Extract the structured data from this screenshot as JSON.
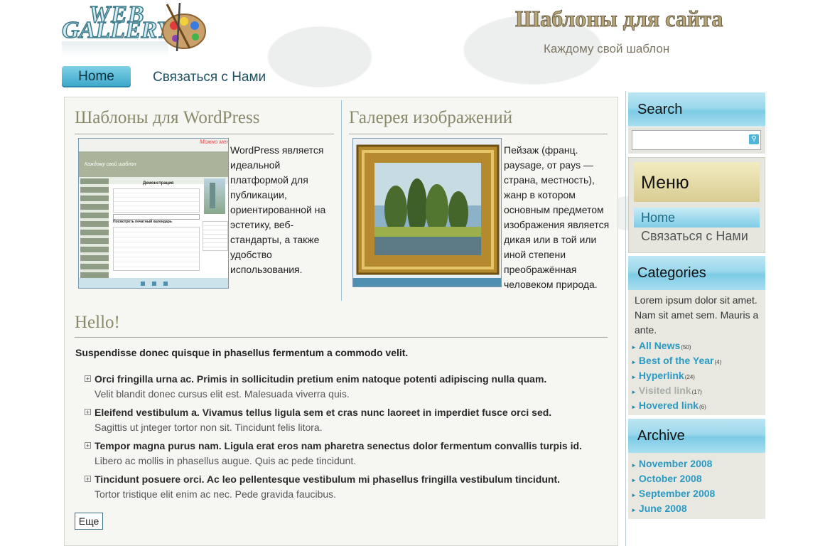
{
  "header": {
    "logo_word1": "WEB",
    "logo_word2": "GALLERY",
    "site_title": "Шаблоны для сайта",
    "slogan": "Каждому свой шаблон"
  },
  "topnav": {
    "home": "Home",
    "contact": "Связаться с Нами"
  },
  "wordpress": {
    "title": "Шаблоны для WordPress",
    "text": "WordPress является идеальной платформой для публикации, ориентированной на эстетику, веб-стандарты, а также удобство использования."
  },
  "gallery": {
    "title": "Галерея изображений",
    "text": "Пейзаж  (франц. paysage, от pays — страна, местность), жанр  в котором основным предметом изображения является дикая или в той или иной степени преображённая человеком природа."
  },
  "hello": {
    "title": "Hello!",
    "intro": "Suspendisse donec quisque in phasellus fermentum a commodo velit.",
    "items": [
      {
        "head": "Orci fringilla urna ac. Primis in sollicitudin pretium enim natoque potenti adipiscing nulla quam.",
        "sub": "Velit blandit donec cursus elit est. Malesuada viverra quis."
      },
      {
        "head": "Eleifend vestibulum a. Vivamus tellus ligula sem et cras nunc laoreet in imperdiet fusce orci sed.",
        "sub": "Sagittis ut jnteger tortor non sit. Tincidunt felis litora."
      },
      {
        "head": "Tempor magna purus nam. Ligula erat eros nam pharetra senectus dolor fermentum convallis turpis id.",
        "sub": "Libero ac mollis in phasellus augue. Quis ac pede tincidunt."
      },
      {
        "head": "Tincidunt posuere orci. Ac leo pellentesque vestibulum mi phasellus fringilla vestibulum tincidunt.",
        "sub": "Tortor tristique elit enim ac nec. Pede gravida faucibus."
      }
    ],
    "more": "Еще"
  },
  "sidebar": {
    "search_title": "Search",
    "menu_title": "Меню",
    "menu_items": [
      "Home",
      "Связаться с Нами"
    ],
    "categories_title": "Categories",
    "categories_text": "Lorem ipsum dolor sit amet. Nam sit amet sem. Mauris a ante.",
    "categories": [
      {
        "label": "All News",
        "count": "(50)"
      },
      {
        "label": "Best of the Year",
        "count": "(4)"
      },
      {
        "label": "Hyperlink",
        "count": "(24)"
      },
      {
        "label": "Visited link",
        "count": "(17)"
      },
      {
        "label": "Hovered link",
        "count": "(6)"
      }
    ],
    "archive_title": "Archive",
    "archive": [
      "November 2008",
      "October 2008",
      "September 2008",
      "June 2008"
    ]
  },
  "screenshot_thumb": {
    "header_text": "Каждому свой шаблон",
    "handwritten": "Можно менять",
    "table_title": "Демонстрация",
    "calendar_title": "Посмотреть печатный календарь"
  },
  "colors": {
    "accent": "#3aa6c9",
    "link": "#2a9ac3",
    "title": "#8a8a6a"
  }
}
